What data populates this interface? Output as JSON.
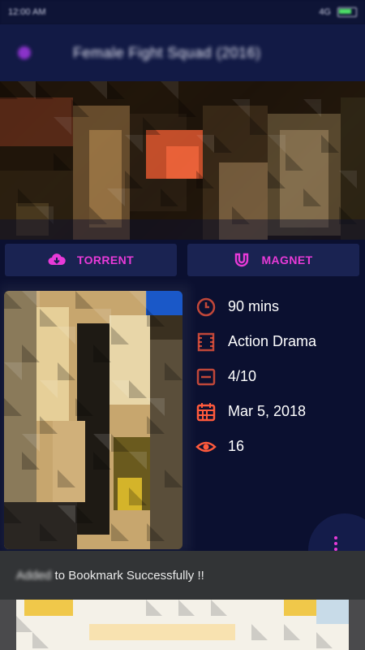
{
  "status_bar": {
    "time": "12:00 AM",
    "network": "4G"
  },
  "app_bar": {
    "title": "Female Fight Squad (2016)"
  },
  "downloads": {
    "torrent_label": "TORRENT",
    "magnet_label": "MAGNET"
  },
  "movie_info": {
    "runtime": "90 mins",
    "genre": "Action Drama",
    "rating": "4/10",
    "release_date": "Mar 5, 2018",
    "views": "16"
  },
  "snackbar": {
    "prefix": "Added",
    "message": "to Bookmark Successfully !!"
  },
  "colors": {
    "accent": "#e83ad8",
    "icon_accent": "#ff5a3c",
    "appbar": "#121a45",
    "background": "#0b1030"
  }
}
